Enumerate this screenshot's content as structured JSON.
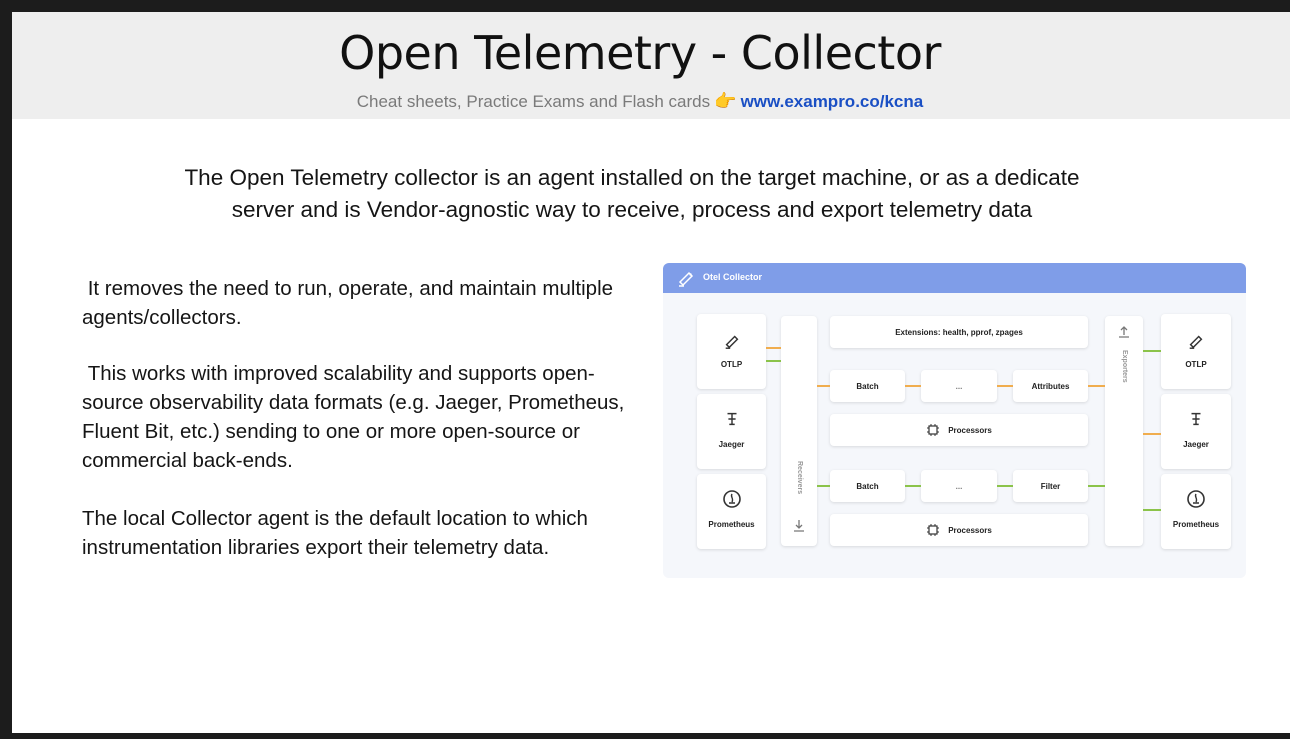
{
  "header": {
    "title": "Open Telemetry - Collector",
    "subtitle": "Cheat sheets, Practice Exams and Flash cards",
    "link": "www.exampro.co/kcna"
  },
  "intro": {
    "line1": "The Open Telemetry collector is an agent installed on the target machine, or as a dedicate",
    "line2": "server and is Vendor-agnostic way to receive, process and export telemetry data"
  },
  "paragraphs": {
    "p1": " It removes the need to run, operate, and maintain multiple agents/collectors.",
    "p2": " This works with improved scalability and supports open-source observability data formats (e.g. Jaeger, Prometheus, Fluent Bit, etc.) sending to one or more open-source or commercial back-ends.",
    "p3": "The local Collector agent is the default location to which instrumentation libraries export their telemetry data."
  },
  "diagram": {
    "title": "Otel Collector",
    "receivers_label": "Receivers",
    "exporters_label": "Exporters",
    "extensions": "Extensions: health, pprof, zpages",
    "inputs": [
      "OTLP",
      "Jaeger",
      "Prometheus"
    ],
    "outputs": [
      "OTLP",
      "Jaeger",
      "Prometheus"
    ],
    "pipeline1": {
      "first": "Batch",
      "middle": "...",
      "last": "Attributes",
      "processors": "Processors"
    },
    "pipeline2": {
      "first": "Batch",
      "middle": "...",
      "last": "Filter",
      "processors": "Processors"
    },
    "colors": {
      "bar": "#7f9de8",
      "link_orange": "#f0ad4e",
      "link_green": "#8bc34a"
    }
  }
}
